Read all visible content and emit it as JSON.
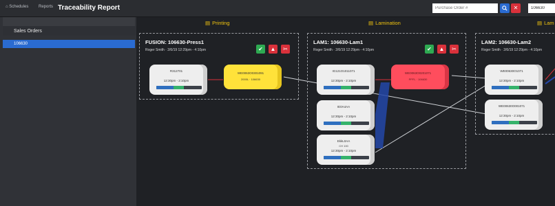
{
  "header": {
    "nav_schedules": "Schedules",
    "nav_reports": "Reports",
    "title": "Traceability Report",
    "po_placeholder": "Purchase Order #",
    "search_icon": "search-icon",
    "clear_icon": "close-icon",
    "id_value": "106630"
  },
  "sidebar": {
    "heading": "Sales Orders",
    "items": [
      {
        "label": "106630",
        "selected": true
      }
    ]
  },
  "stages": [
    {
      "label": "Printing",
      "icon": "printer-icon"
    },
    {
      "label": "Lamination",
      "icon": "layers-icon"
    },
    {
      "label": "Lam",
      "icon": "layers-icon"
    }
  ],
  "groups": [
    {
      "title": "FUSION: 106630-Press1",
      "sub": "Roger Smith  · 2/6/19 12:29pm - 4:10pm",
      "cards": [
        {
          "color": "white",
          "line1": "R312701",
          "line2": "12:30pm - 2:10pm",
          "progress": 0.85
        },
        {
          "color": "yellow",
          "line1": "WE0063O0301091",
          "line2": "2000L · 106630"
        }
      ]
    },
    {
      "title": "LAM1: 106630-Lam1",
      "sub": "Roger Smith  · 2/6/19 12:29pm - 4:10pm",
      "cards": [
        {
          "color": "white",
          "line1": "IG121O1011071",
          "line2": "12:30pm - 2:10pm",
          "progress": 0.85
        },
        {
          "color": "red",
          "line1": "WE0063O0201071",
          "line2": "PPFL · 106630"
        },
        {
          "color": "white",
          "line1": "IE0A4AA",
          "line2": "12:30pm - 2:10pm",
          "progress": 0.85
        },
        {
          "color": "white",
          "line1": "EkkL0AA",
          "line2": "12:30pm - 2:10pm",
          "line_extra": "CH 100",
          "progress": 0.85
        }
      ]
    },
    {
      "title": "LAM2: 106630-Lam2",
      "sub": "Roger Smith  · 2/6/19 12:29pm - 4:10pm",
      "cards": [
        {
          "color": "white",
          "line1": "WE00630O1071",
          "line2": "12:30pm - 2:10pm",
          "progress": 0.85
        },
        {
          "color": "white",
          "line1": "WE00630O001071",
          "line2": "12:30pm - 2:10pm",
          "progress": 0.85
        }
      ]
    }
  ],
  "colors": {
    "accent": "#2a6bd1",
    "ok": "#2eaa52",
    "danger": "#d9313b",
    "highlight_yellow": "#ffe23a",
    "highlight_red": "#ff4d5d",
    "stage_header": "#f1c40f",
    "progress_blue": "#2f6fbf",
    "progress_green": "#35b36b"
  }
}
